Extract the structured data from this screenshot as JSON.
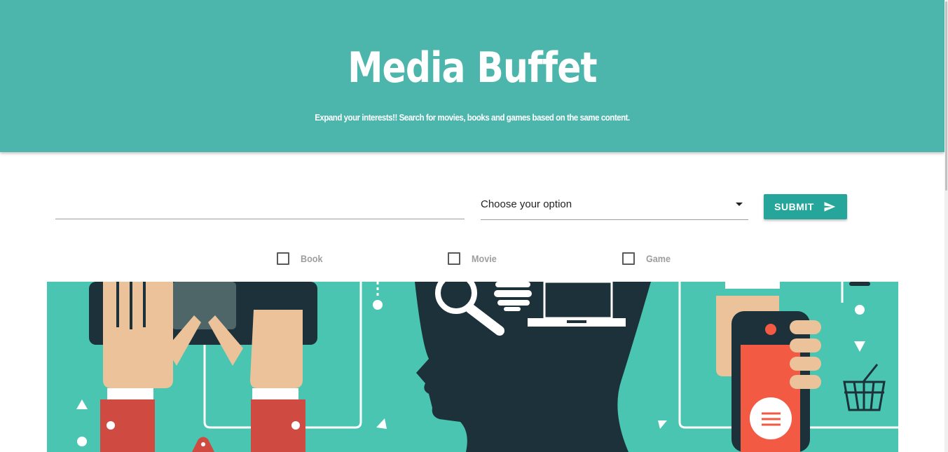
{
  "header": {
    "title": "Media Buffet",
    "subtitle": "Expand your interests!! Search for movies, books and games based on the same content."
  },
  "search": {
    "input_value": "",
    "select_value": "Choose your option",
    "submit_label": "SUBMIT"
  },
  "filters": [
    {
      "label": "Book",
      "checked": false
    },
    {
      "label": "Movie",
      "checked": false
    },
    {
      "label": "Game",
      "checked": false
    }
  ],
  "hero": {
    "description": "media illustration"
  },
  "colors": {
    "header_bg": "#4db6ac",
    "button_bg": "#26a69a",
    "hero_bg": "#49c5b1",
    "hero_dark": "#1c3139",
    "hero_skin": "#ecc29a",
    "hero_red": "#cf4a41",
    "hero_orange": "#f25a43"
  },
  "icons": {
    "submit": "send-icon",
    "select": "caret-down-icon"
  }
}
